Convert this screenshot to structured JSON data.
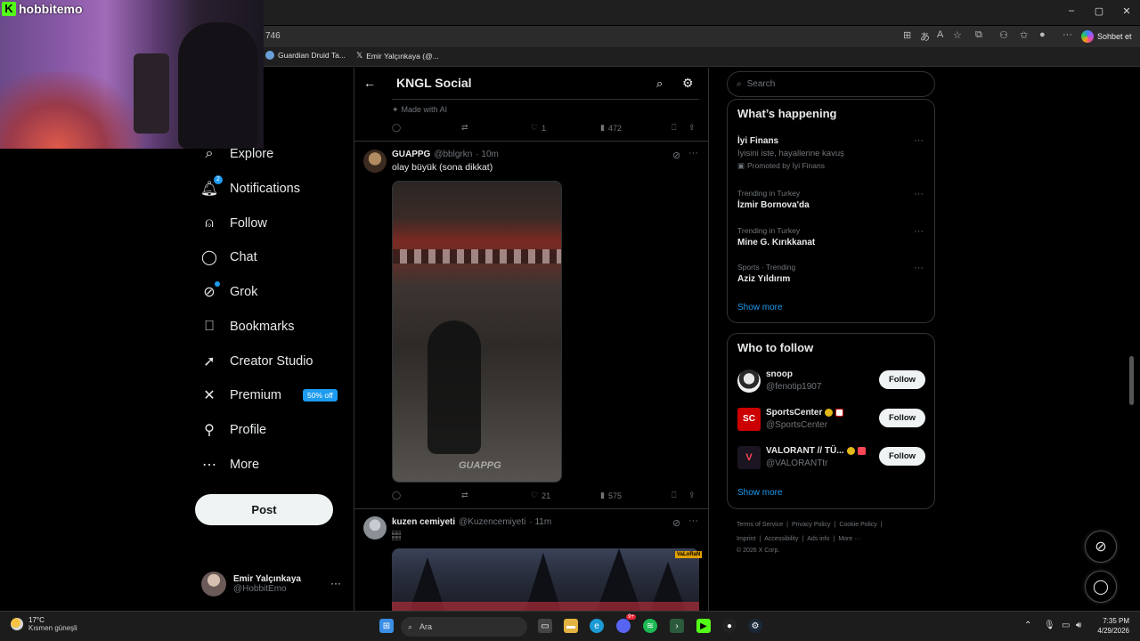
{
  "browser": {
    "address_fragment": "746",
    "tabs": [
      {
        "label": "Guardian Druid Ta..."
      },
      {
        "label": "Emir Yalçınkaya (@..."
      }
    ],
    "copilot_label": "Sohbet et",
    "window_buttons": {
      "minimize": "–",
      "maximize": "▢",
      "close": "✕"
    }
  },
  "webcam": {
    "logo_text": "hobbitemo",
    "logo_mark": "K"
  },
  "nav": {
    "items": [
      {
        "label": "Explore",
        "icon": "search-icon"
      },
      {
        "label": "Notifications",
        "icon": "bell-icon",
        "badge": "2"
      },
      {
        "label": "Follow",
        "icon": "person-plus-icon"
      },
      {
        "label": "Chat",
        "icon": "chat-bubble-icon"
      },
      {
        "label": "Grok",
        "icon": "grok-icon"
      },
      {
        "label": "Bookmarks",
        "icon": "bookmark-icon"
      },
      {
        "label": "Creator Studio",
        "icon": "rocket-icon"
      },
      {
        "label": "Premium",
        "icon": "x-logo-icon",
        "pill": "50% off"
      },
      {
        "label": "Profile",
        "icon": "person-icon"
      },
      {
        "label": "More",
        "icon": "more-circle-icon"
      }
    ],
    "post_label": "Post",
    "account": {
      "name": "Emir Yalçınkaya",
      "handle": "@HobbitEmo"
    }
  },
  "feed": {
    "title": "KNGL Social",
    "prev_tweet": {
      "ai_label": "Made with AI",
      "likes": "1",
      "views": "472"
    },
    "tweets": [
      {
        "name": "GUAPPG",
        "handle": "@bblgrkn",
        "time": "· 10m",
        "text": "olay büyük (sona dikkat)",
        "likes": "21",
        "views": "575",
        "watermark": "GUAPPG"
      },
      {
        "name": "kuzen cemiyeti",
        "handle": "@Kuzencemiyeti",
        "time": "· 11m",
        "text": "🏽",
        "media_tag": "VaLoRaN"
      }
    ]
  },
  "right": {
    "search_placeholder": "Search",
    "happening": {
      "title": "What’s happening",
      "items": [
        {
          "name": "İyi Finans",
          "sub": "İyisini iste, hayallerine kavuş",
          "meta": "Promoted by İyi Finans"
        },
        {
          "meta": "Trending in Turkey",
          "name": "İzmir Bornova'da"
        },
        {
          "meta": "Trending in Turkey",
          "name": "Mine G. Kırıkkanat"
        },
        {
          "meta": "Sports · Trending",
          "name": "Aziz Yıldırım"
        }
      ],
      "show_more": "Show more"
    },
    "who_to_follow": {
      "title": "Who to follow",
      "users": [
        {
          "name": "snoop",
          "handle": "@fenotip1907",
          "button": "Follow"
        },
        {
          "name": "SportsCenter",
          "handle": "@SportsCenter",
          "button": "Follow"
        },
        {
          "name": "VALORANT // TÜ...",
          "handle": "@VALORANTtr",
          "button": "Follow"
        }
      ],
      "show_more": "Show more"
    },
    "footer": {
      "line1": [
        "Terms of Service",
        "Privacy Policy",
        "Cookie Policy"
      ],
      "line2": [
        "Imprint",
        "Accessibility",
        "Ads info",
        "More ···"
      ],
      "copyright": "© 2026 X Corp."
    }
  },
  "taskbar": {
    "weather_temp": "17°C",
    "weather_desc": "Kısmen güneşli",
    "search_placeholder": "Ara",
    "time": "7:35 PM",
    "date": "4/29/2026",
    "discord_badge": "9+"
  },
  "colors": {
    "accent": "#1d9bf0",
    "background": "#000000",
    "border": "#2f3336",
    "muted": "#71767b"
  }
}
